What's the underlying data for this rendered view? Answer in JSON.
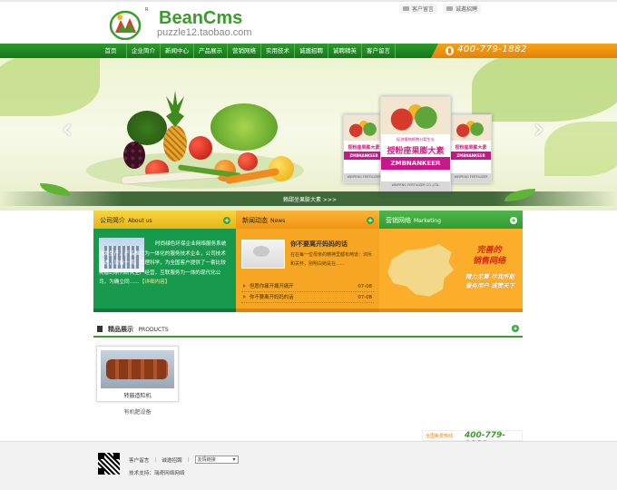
{
  "brand": {
    "name": "BeanCms",
    "sub": "puzzle12.taobao.com",
    "reg": "R"
  },
  "toplinks": [
    "客户留言",
    "诚邀招聘"
  ],
  "nav": [
    "首页",
    "企业简介",
    "新闻中心",
    "产品展示",
    "营销网络",
    "实用技术",
    "诚邀招聘",
    "诚聘精英",
    "客户留言"
  ],
  "hotline": "400-779-1882",
  "banner": {
    "caption": "赖甜坐果膨大素 >>>",
    "package": {
      "small_top": "促进植物细胞分裂生长",
      "title": "授粉座果膨大素",
      "band": "ZMBNANKEER",
      "footer": "WEIPENG FERTILIZER CO.,LTD."
    }
  },
  "about": {
    "title_cn": "公司简介",
    "title_en": "About us",
    "text": "时尚绿色环保企业网络服务系统研发生产，产品推广为一体化的服务技术企业，公司技术先进，设备一流，管理科学，为全国客户提供了一套比较完善的系列研究生产经营，互联服务为一体的现代化公司，为确立同……",
    "more": "【详细内容】"
  },
  "news": {
    "title_cn": "新闻动态",
    "title_en": "News",
    "headline": "你不要离开妈妈的话",
    "desc": "在在每一位母亲的精神里都有两道：训斥和关怀，别明白她是在……",
    "items": [
      {
        "title": "但愿你痛开痛开痛开",
        "date": "07-08"
      },
      {
        "title": "你不要离开妈妈的话",
        "date": "07-08"
      }
    ]
  },
  "marketing": {
    "title_cn": "营销网络",
    "title_en": "Marketing",
    "slogan_main": "完善的\n销售网络",
    "slogan_sub": "精力至算 尽我所能\n服务用户 诚赞天下"
  },
  "products": {
    "title_cn": "精品展示",
    "title_en": "PRODUCTS",
    "items": [
      {
        "name": "转鼓造粒机",
        "category": "有机肥设备"
      }
    ]
  },
  "footer": {
    "free_label": "全国免费热线：",
    "free_number": "400-779-1882",
    "links": [
      "客户留言",
      "诚邀招聘"
    ],
    "select_value": "友情链接",
    "tech": "技术支持：瑞奇网络网络"
  },
  "colors": {
    "green": "#3a9d2a",
    "orange": "#f09414",
    "yellow": "#e9b515",
    "about_bg": "#189a4d"
  }
}
